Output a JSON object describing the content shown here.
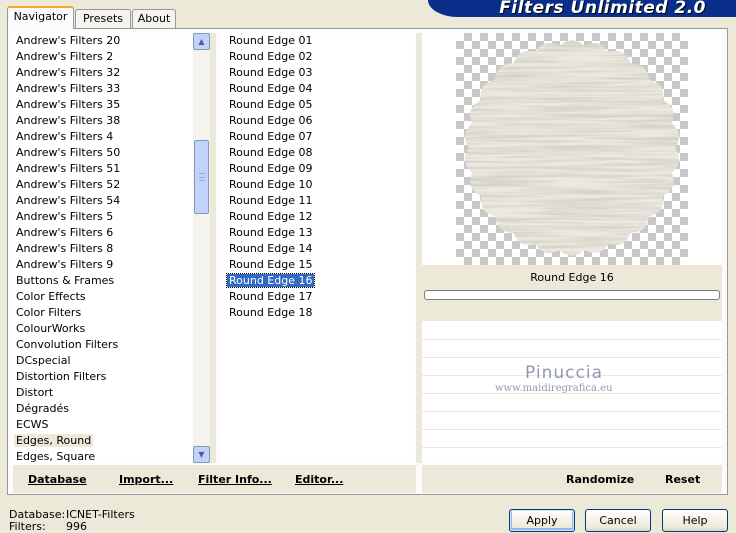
{
  "tabs": [
    {
      "label": "Navigator",
      "active": true
    },
    {
      "label": "Presets",
      "active": false
    },
    {
      "label": "About",
      "active": false
    }
  ],
  "banner": {
    "title": "Filters Unlimited 2.0"
  },
  "categories": [
    "Andrew's Filters 20",
    "Andrew's Filters 2",
    "Andrew's Filters 32",
    "Andrew's Filters 33",
    "Andrew's Filters 35",
    "Andrew's Filters 38",
    "Andrew's Filters 4",
    "Andrew's Filters 50",
    "Andrew's Filters 51",
    "Andrew's Filters 52",
    "Andrew's Filters 54",
    "Andrew's Filters 5",
    "Andrew's Filters 6",
    "Andrew's Filters 8",
    "Andrew's Filters 9",
    "Buttons & Frames",
    "Color Effects",
    "Color Filters",
    "ColourWorks",
    "Convolution Filters",
    "DCspecial",
    "Distortion Filters",
    "Distort",
    "Dégradés",
    "ECWS",
    "Edges, Round",
    "Edges, Square"
  ],
  "selected_category": "Edges, Round",
  "filters": [
    "Round Edge 01",
    "Round Edge 02",
    "Round Edge 03",
    "Round Edge 04",
    "Round Edge 05",
    "Round Edge 06",
    "Round Edge 07",
    "Round Edge 08",
    "Round Edge 09",
    "Round Edge 10",
    "Round Edge 11",
    "Round Edge 12",
    "Round Edge 13",
    "Round Edge 14",
    "Round Edge 15",
    "Round Edge 16",
    "Round Edge 17",
    "Round Edge 18"
  ],
  "selected_filter": "Round Edge 16",
  "preview": {
    "label": "Round Edge 16"
  },
  "watermark": {
    "title": "Pinuccia",
    "url": "www.maidiregrafica.eu"
  },
  "left_buttons": {
    "database": "Database",
    "import": "Import...",
    "filter_info": "Filter Info...",
    "editor": "Editor..."
  },
  "right_buttons": {
    "randomize": "Randomize",
    "reset": "Reset"
  },
  "footer": {
    "database_label": "Database:",
    "database_value": "ICNET-Filters",
    "filters_label": "Filters:",
    "filters_value": "996"
  },
  "dialog_buttons": {
    "apply": "Apply",
    "cancel": "Cancel",
    "help": "Help"
  },
  "colors": {
    "selection": "#316ac5",
    "banner": "#0a2f8a",
    "panel": "#ece9d8"
  }
}
